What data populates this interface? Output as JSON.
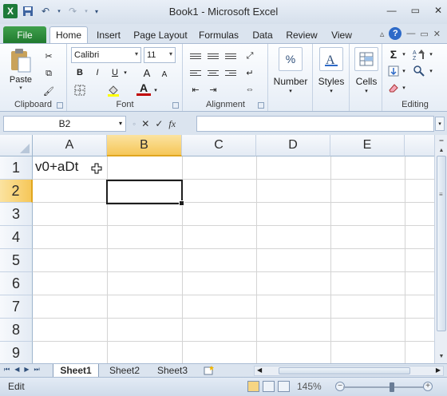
{
  "window": {
    "title": "Book1  -  Microsoft Excel",
    "logo": "X",
    "controls": [
      "minimize-icon",
      "maximize-icon",
      "close-icon"
    ]
  },
  "ribbon_tabs": [
    "File",
    "Home",
    "Insert",
    "Page Layout",
    "Formulas",
    "Data",
    "Review",
    "View"
  ],
  "active_tab": "Home",
  "ribbon": {
    "font_name": "Calibri",
    "font_size": "11",
    "bold": "B",
    "italic": "I",
    "underline": "U",
    "grow_font": "A",
    "shrink_font": "A",
    "font_color": "A",
    "paste_label": "Paste",
    "number_label": "Number",
    "number_symbol": "%",
    "styles_label": "Styles",
    "cells_label": "Cells",
    "groups": {
      "clipboard": "Clipboard",
      "font": "Font",
      "alignment": "Alignment",
      "editing": "Editing"
    },
    "sum_symbol": "Σ"
  },
  "formula_bar": {
    "name_box": "B2",
    "fx": "fx",
    "cancel": "✕",
    "enter": "✓",
    "formula": ""
  },
  "grid": {
    "columns": [
      "A",
      "B",
      "C",
      "D",
      "E"
    ],
    "rows": [
      "1",
      "2",
      "3",
      "4",
      "5",
      "6",
      "7",
      "8",
      "9"
    ],
    "selected_column": "B",
    "selected_row": "2",
    "cells": {
      "A1": "v0+aDt"
    }
  },
  "sheets": [
    "Sheet1",
    "Sheet2",
    "Sheet3"
  ],
  "active_sheet": "Sheet1",
  "status": {
    "mode": "Edit",
    "zoom": "145%",
    "zoom_minus": "−",
    "zoom_plus": "+",
    "zoom_level": 0.6
  }
}
